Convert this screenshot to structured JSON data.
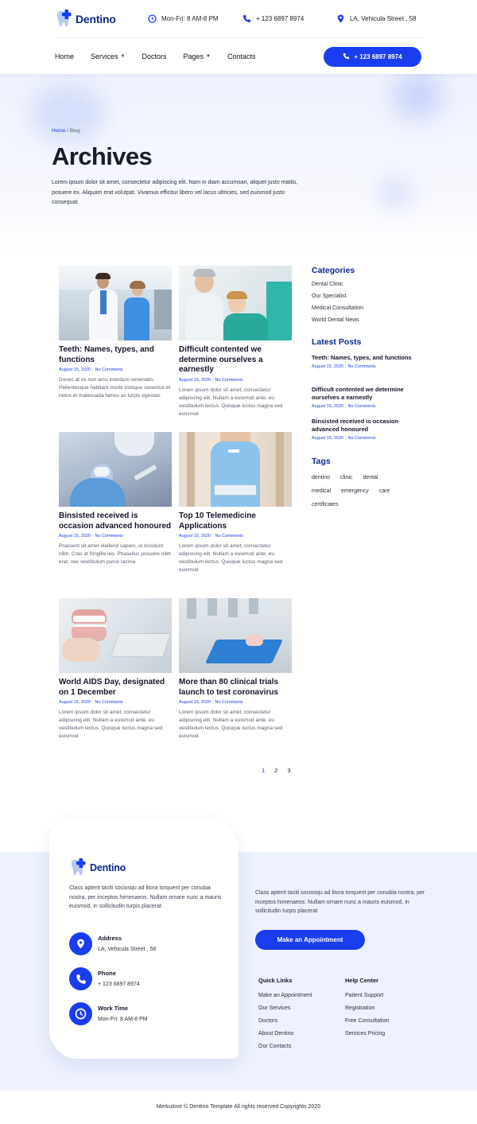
{
  "brand": {
    "name": "Dentino",
    "accent": "#1a3df0",
    "navy": "#0b2a8c"
  },
  "topbar": {
    "hours": "Mon-Fri: 8 AM-8 PM",
    "phone": "+ 123 6897 8974",
    "address": "LA, Vehicula Street , 58"
  },
  "nav": {
    "items": [
      {
        "label": "Home",
        "dropdown": false
      },
      {
        "label": "Services",
        "dropdown": true
      },
      {
        "label": "Doctors",
        "dropdown": false
      },
      {
        "label": "Pages",
        "dropdown": true
      },
      {
        "label": "Contacts",
        "dropdown": false
      }
    ],
    "cta_label": "+ 123 6897 8974"
  },
  "hero": {
    "breadcrumb_home": "Home",
    "breadcrumb_current": "/ Blog",
    "title": "Archives",
    "description": "Lorem ipsum dolor sit amet, consectetur adipiscing elit. Nam in diam accumsan, aliquet justo mattis, posuere ex. Aliquam erat volutpat. Vivamus efficitur libero vel lacus ultricies, sed euismod justo consequat."
  },
  "posts": [
    {
      "title": "Teeth: Names, types, and functions",
      "date": "August 15, 2020",
      "comments": "No Comments",
      "excerpt": "Donec at mi non arcu interdum venenatis. Pellentesque habitant morbi tristique senectus et netus et malesuada fames ac turpis egestas."
    },
    {
      "title": "Difficult contented we determine ourselves a earnestly",
      "date": "August 15, 2020",
      "comments": "No Comments",
      "excerpt": "Lorem ipsum dolor sit amet, consectetur adipiscing elit. Nullam a euismod ante, eu vestibulum lectus. Quisque luctus magna sed euismod"
    },
    {
      "title": "Binsisted received is occasion advanced honoured",
      "date": "August 15, 2020",
      "comments": "No Comments",
      "excerpt": "Praesent sit amet eleifend sapien, ut tincidunt nibh. Cras at fringilla leo. Phasellus posuere nibh erat, nec vestibulum purus lacinia"
    },
    {
      "title": "Top 10 Telemedicine Applications",
      "date": "August 15, 2020",
      "comments": "No Comments",
      "excerpt": "Lorem ipsum dolor sit amet, consectetur adipiscing elit. Nullam a euismod ante, eu vestibulum lectus. Quisque luctus magna sed euismod"
    },
    {
      "title": "World AIDS Day, designated on 1 December",
      "date": "August 15, 2020",
      "comments": "No Comments",
      "excerpt": "Lorem ipsum dolor sit amet, consectetur adipiscing elit. Nullam a euismod ante, eu vestibulum lectus. Quisque luctus magna sed euismod"
    },
    {
      "title": "More than 80 clinical trials launch to test coronavirus",
      "date": "August 15, 2020",
      "comments": "No Comments",
      "excerpt": "Lorem ipsum dolor sit amet, consectetur adipiscing elit. Nullam a euismod ante, eu vestibulum lectus. Quisque luctus magna sed euismod"
    }
  ],
  "pagination": {
    "pages": [
      "1",
      "2",
      "3"
    ],
    "current": "1"
  },
  "sidebar": {
    "categories_title": "Categories",
    "categories": [
      "Dental Clinic",
      "Our Specialist",
      "Medical Consultation",
      "World Dental News"
    ],
    "latest_title": "Latest Posts",
    "latest": [
      {
        "title": "Teeth: Names, types, and functions",
        "date": "August 15, 2020",
        "comments": "No Comments"
      },
      {
        "title": "Difficult contented we determine ourselves a earnestly",
        "date": "August 15, 2020",
        "comments": "No Comments"
      },
      {
        "title": "Binsisted received is occasion advanced honoured",
        "date": "August 15, 2020",
        "comments": "No Comments"
      }
    ],
    "tags_title": "Tags",
    "tags": [
      "dentino",
      "clinic",
      "dental",
      "medical",
      "emergency",
      "care",
      "certificates"
    ]
  },
  "footer": {
    "brand": "Dentino",
    "description": "Class aptent taciti sociosqu ad litora torquent per conubia nostra, per inceptos himenaeos. Nullam ornare nunc a mauris euismod, in sollicitudin turpis placerat",
    "contacts": [
      {
        "label": "Address",
        "value": "LA, Vehicula Street , 58",
        "icon": "location-pin-icon"
      },
      {
        "label": "Phone",
        "value": "+ 123 6897 8974",
        "icon": "phone-icon"
      },
      {
        "label": "Work Time",
        "value": "Mon-Fri: 8 AM-8 PM",
        "icon": "clock-icon"
      }
    ],
    "right_description": "Class aptent taciti sociosqu ad litora torquent per conubia nostra, per inceptos himenaeos. Nullam ornare nunc a mauris euismod, in sollicitudin turpis placerat",
    "appointment_label": "Make an Appointment",
    "quick_links_title": "Quick Links",
    "quick_links": [
      "Make an Appointment",
      "Our Services",
      "Doctors",
      "About Dentino",
      "Our Contacts"
    ],
    "help_title": "Help Center",
    "help_links": [
      "Patient Support",
      "Registration",
      "Free Consultation",
      "Services Pricing"
    ],
    "copyright": "Merkulove © Dentino Template All rights reserved Copyrights 2020"
  }
}
